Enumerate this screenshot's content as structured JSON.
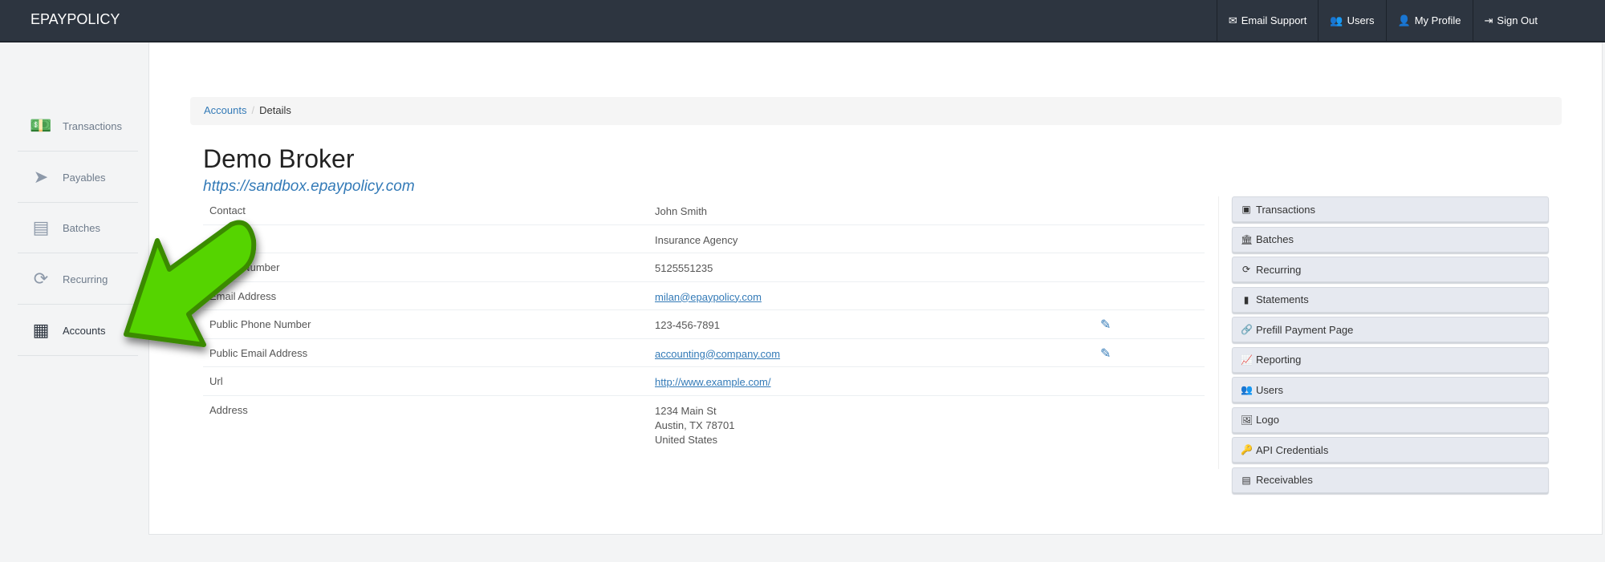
{
  "nav": {
    "brand": "EPAYPOLICY",
    "items": [
      {
        "icon": "envelope-icon",
        "label": "Email Support"
      },
      {
        "icon": "users-icon",
        "label": "Users"
      },
      {
        "icon": "user-icon",
        "label": "My Profile"
      },
      {
        "icon": "sign-out-icon",
        "label": "Sign Out"
      }
    ]
  },
  "sidebar": {
    "items": [
      {
        "label": "Transactions",
        "icon": "money-icon"
      },
      {
        "label": "Payables",
        "icon": "paper-plane-icon"
      },
      {
        "label": "Batches",
        "icon": "archive-icon"
      },
      {
        "label": "Recurring",
        "icon": "refresh-icon"
      },
      {
        "label": "Accounts",
        "icon": "building-icon",
        "active": true
      }
    ]
  },
  "breadcrumb": {
    "parent": "Accounts",
    "current": "Details",
    "sep": "/"
  },
  "account": {
    "name": "Demo Broker",
    "url": "https://sandbox.epaypolicy.com"
  },
  "details": [
    {
      "label": "Contact",
      "value": "John Smith"
    },
    {
      "label": "Category",
      "value": "Insurance Agency"
    },
    {
      "label": "Phone Number",
      "value": "5125551235"
    },
    {
      "label": "Email Address",
      "value": "milan@epaypolicy.com"
    },
    {
      "label": "Public Phone Number",
      "value": "123-456-7891"
    },
    {
      "label": "Public Email Address",
      "value": "accounting@company.com"
    },
    {
      "label": "Url",
      "value": "http://www.example.com/"
    },
    {
      "label": "Address",
      "line1": "1234 Main St",
      "line2": "Austin, TX 78701",
      "line3": "United States"
    }
  ],
  "actions": [
    {
      "label": "Transactions",
      "icon": "money-icon"
    },
    {
      "label": "Batches",
      "icon": "bank-icon"
    },
    {
      "label": "Recurring",
      "icon": "refresh-icon"
    },
    {
      "label": "Statements",
      "icon": "file-icon"
    },
    {
      "label": "Prefill Payment Page",
      "icon": "link-icon"
    },
    {
      "label": "Reporting",
      "icon": "line-chart-icon"
    },
    {
      "label": "Users",
      "icon": "users-icon"
    },
    {
      "label": "Logo",
      "icon": "image-icon"
    },
    {
      "label": "API Credentials",
      "icon": "key-icon"
    },
    {
      "label": "Receivables",
      "icon": "cash-register-icon"
    }
  ],
  "colors": {
    "navbar": "#2d3540",
    "link": "#337ab7",
    "arrow": "#55d400",
    "arrow_outline": "#3a8a00"
  }
}
